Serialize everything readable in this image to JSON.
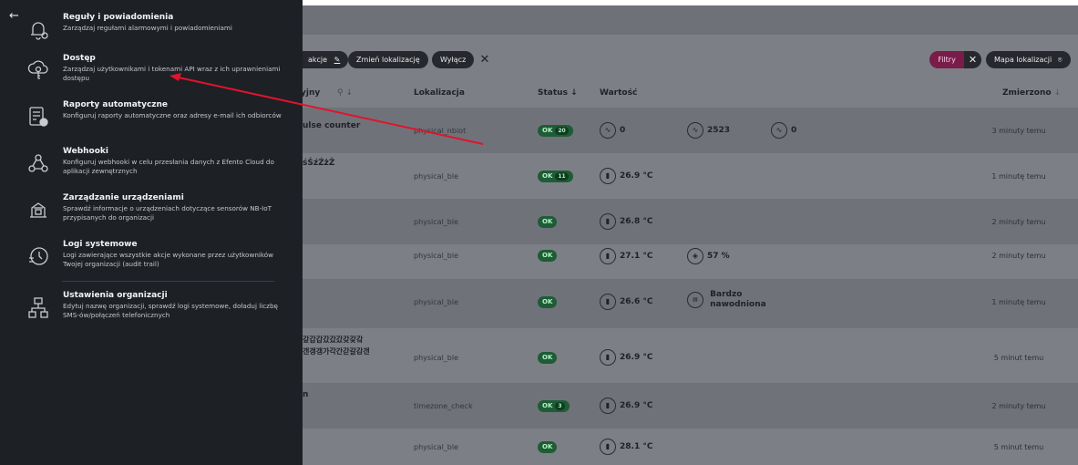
{
  "toolbar": {
    "actions_label": "akcje",
    "change_location_label": "Zmień lokalizację",
    "turn_off_label": "Wyłącz",
    "filters_label": "Filtry",
    "location_map_label": "Mapa lokalizacji"
  },
  "table": {
    "headers": {
      "name": "yjny",
      "location": "Lokalizacja",
      "status": "Status",
      "value": "Wartość",
      "measured": "Zmierzono"
    },
    "rows": [
      {
        "name": "ulse counter",
        "location": "physical_nbiot",
        "status": "OK",
        "count": "20",
        "values": [
          "0",
          "2523",
          "0"
        ],
        "time": "3 minuty temu"
      },
      {
        "name": "śŚźŹżŻ",
        "location": "physical_ble",
        "status": "OK",
        "count": "11",
        "values": [
          "26.9 °C"
        ],
        "time": "1 minutę temu"
      },
      {
        "name": "",
        "location": "physical_ble",
        "status": "OK",
        "count": "",
        "values": [
          "26.8 °C"
        ],
        "time": "2 minuty temu"
      },
      {
        "name": "",
        "location": "physical_ble",
        "status": "OK",
        "count": "",
        "values": [
          "27.1 °C",
          "57 %"
        ],
        "time": "2 minuty temu"
      },
      {
        "name": "",
        "location": "physical_ble",
        "status": "OK",
        "count": "",
        "values": [
          "26.6 °C",
          "Bardzo",
          "nawodniona"
        ],
        "time": "1 minutę temu"
      },
      {
        "name": "갚갑갑갔갔갔갖갗갘",
        "name2": "갠갱갱가각간갇갈감갠",
        "location": "physical_ble",
        "status": "OK",
        "count": "",
        "values": [
          "26.9 °C"
        ],
        "time": "5 minut temu"
      },
      {
        "name": "n",
        "location": "timezone_check",
        "status": "OK",
        "count": "3",
        "values": [
          "26.9 °C"
        ],
        "time": "2 minuty temu"
      },
      {
        "name": "",
        "location": "physical_ble",
        "status": "OK",
        "count": "",
        "values": [
          "28.1 °C"
        ],
        "time": "5 minut temu"
      }
    ]
  },
  "panel": {
    "items": [
      {
        "title": "Reguły i powiadomienia",
        "desc": "Zarządzaj regułami alarmowymi i powiadomieniami",
        "icon": "bell-gear-icon"
      },
      {
        "title": "Dostęp",
        "desc": "Zarządzaj użytkownikami i tokenami API wraz z ich uprawnieniami dostępu",
        "icon": "cloud-key-icon"
      },
      {
        "title": "Raporty automatyczne",
        "desc": "Konfiguruj raporty automatyczne oraz adresy e-mail ich odbiorców",
        "icon": "report-icon"
      },
      {
        "title": "Webhooki",
        "desc": "Konfiguruj webhooki w celu przesłania danych z Efento Cloud do aplikacji zewnętrznych",
        "icon": "webhook-icon"
      },
      {
        "title": "Zarządzanie urządzeniami",
        "desc": "Sprawdź informacje o urządzeniach dotyczące sensorów NB-IoT przypisanych do organizacji",
        "icon": "devices-icon"
      },
      {
        "title": "Logi systemowe",
        "desc": "Logi zawierające wszystkie akcje wykonane przez użytkowników Twojej organizacji (audit trail)",
        "icon": "logs-icon"
      },
      {
        "title": "Ustawienia organizacji",
        "desc": "Edytuj nazwę organizacji, sprawdź logi systemowe, doładuj liczbę SMS-ów/połączeń telefonicznych",
        "icon": "organization-icon"
      }
    ]
  },
  "colors": {
    "accent": "#e0142d",
    "panel_bg": "#1d2025",
    "status_ok": "#1e5c36",
    "filter": "#7a1c4a"
  }
}
